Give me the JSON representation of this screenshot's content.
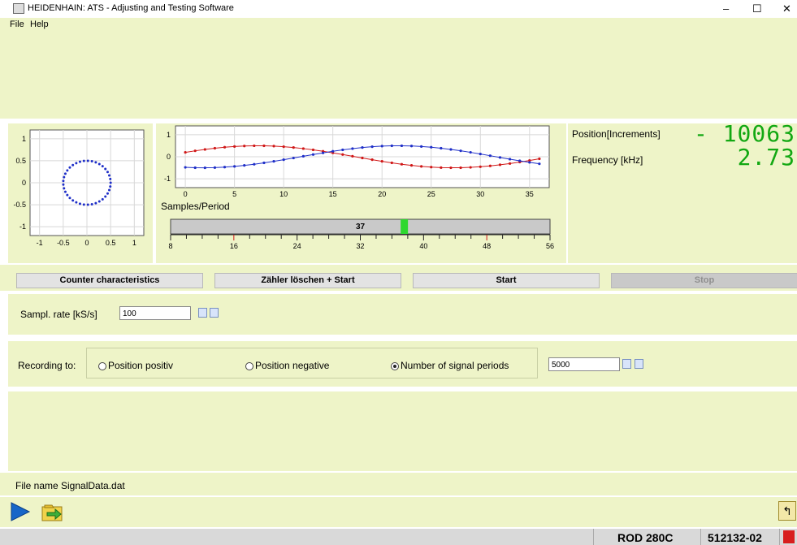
{
  "window": {
    "title": "HEIDENHAIN: ATS - Adjusting and Testing Software",
    "controls": {
      "minimize": "–",
      "maximize": "☐",
      "close": "✕"
    }
  },
  "menu": {
    "items": [
      "File",
      "Help"
    ]
  },
  "lissajous": {
    "y_ticks": [
      "1",
      "0.5",
      "0",
      "-0.5",
      "-1"
    ],
    "x_ticks": [
      "-1",
      "-0.5",
      "0",
      "0.5",
      "1"
    ]
  },
  "signal": {
    "y_ticks": [
      "1",
      "0",
      "-1"
    ],
    "x_ticks": [
      "0",
      "5",
      "10",
      "15",
      "20",
      "25",
      "30",
      "35"
    ]
  },
  "samples": {
    "label": "Samples/Period",
    "value": "37",
    "scale": [
      "8",
      "16",
      "24",
      "32",
      "40",
      "48",
      "56"
    ]
  },
  "readout": {
    "position_label": "Position[Increments]",
    "position_value": "- 10063",
    "frequency_label": "Frequency [kHz]",
    "frequency_value": "2.73"
  },
  "buttons": {
    "counter": "Counter characteristics",
    "clear_start": "Zähler löschen + Start",
    "start": "Start",
    "stop": "Stop"
  },
  "sampling": {
    "label": "Sampl. rate [kS/s]",
    "value": "100"
  },
  "recording": {
    "label": "Recording to:",
    "option1": "Position positiv",
    "option2": "Position negative",
    "option3": "Number of signal periods",
    "selected": "Number of signal periods",
    "value": "5000"
  },
  "file": {
    "label": "File name",
    "value": "SignalData.dat"
  },
  "status": {
    "device": "ROD 280C",
    "id": "512132-02"
  },
  "chart_data": [
    {
      "type": "scatter",
      "x_ticks": [
        -1,
        -0.5,
        0,
        0.5,
        1
      ],
      "y_ticks": [
        1,
        0.5,
        0,
        -0.5,
        -1
      ],
      "xlim": [
        -1.2,
        1.2
      ],
      "ylim": [
        -1.2,
        1.2
      ],
      "grid": true,
      "series": [
        {
          "shape": "circle",
          "center": [
            0,
            0
          ],
          "radius": 0.5,
          "points": 37,
          "color": "#1f2fc8"
        }
      ]
    },
    {
      "type": "line",
      "x_ticks": [
        0,
        5,
        10,
        15,
        20,
        25,
        30,
        35
      ],
      "y_ticks": [
        1,
        0,
        -1
      ],
      "xlim": [
        -1,
        37
      ],
      "ylim": [
        -1.4,
        1.4
      ],
      "grid": true,
      "series": [
        {
          "color": "#d01818",
          "wave": "sin",
          "amplitude": 0.5,
          "phase_at_zero": 0.2,
          "period": 37,
          "points": 37
        },
        {
          "color": "#1f2fc8",
          "wave": "cos",
          "amplitude": 0.5,
          "phase_at_zero": -0.5,
          "period": 37,
          "points": 37
        }
      ]
    }
  ],
  "colors": {
    "panel": "#eef4c8",
    "accent_green": "#12a812",
    "red": "#d01818",
    "blue": "#1f2fc8"
  }
}
